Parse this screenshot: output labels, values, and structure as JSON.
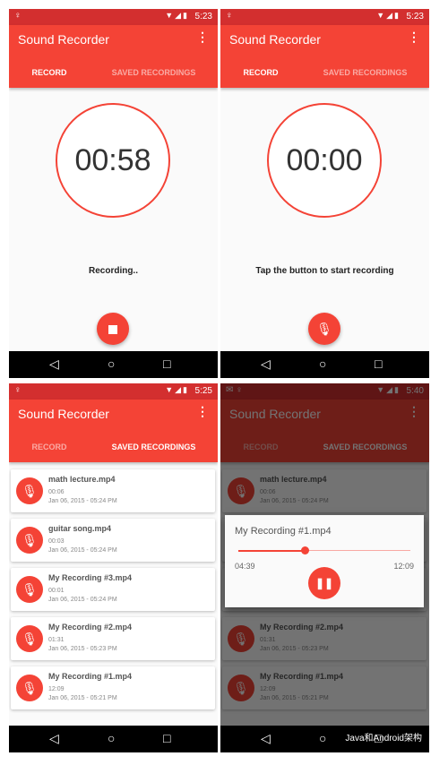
{
  "colors": {
    "primary": "#f44336",
    "status_bar": "#d32f2f"
  },
  "app_title": "Sound Recorder",
  "tabs": [
    "RECORD",
    "SAVED RECORDINGS"
  ],
  "nav_icons": [
    "back-icon",
    "home-icon",
    "recents-icon"
  ],
  "screens": [
    {
      "time": "5:23",
      "active_tab": 0,
      "timer": "00:58",
      "message": "Recording..",
      "fab_icon": "stop-icon"
    },
    {
      "time": "5:23",
      "active_tab": 0,
      "timer": "00:00",
      "message": "Tap the button to start recording",
      "fab_icon": "mic-icon"
    },
    {
      "time": "5:25",
      "active_tab": 1
    },
    {
      "time": "5:40",
      "active_tab": 1
    }
  ],
  "recordings": [
    {
      "name": "math lecture.mp4",
      "length": "00:06",
      "date": "Jan 06, 2015 - 05:24 PM"
    },
    {
      "name": "guitar song.mp4",
      "length": "00:03",
      "date": "Jan 06, 2015 - 05:24 PM"
    },
    {
      "name": "My Recording #3.mp4",
      "length": "00:01",
      "date": "Jan 06, 2015 - 05:24 PM"
    },
    {
      "name": "My Recording #2.mp4",
      "length": "01:31",
      "date": "Jan 06, 2015 - 05:23 PM"
    },
    {
      "name": "My Recording #1.mp4",
      "length": "12:09",
      "date": "Jan 06, 2015 - 05:21 PM"
    }
  ],
  "playback": {
    "title": "My Recording #1.mp4",
    "current": "04:39",
    "total": "12:09",
    "progress": 0.385
  },
  "watermark": "Java和Android架构"
}
